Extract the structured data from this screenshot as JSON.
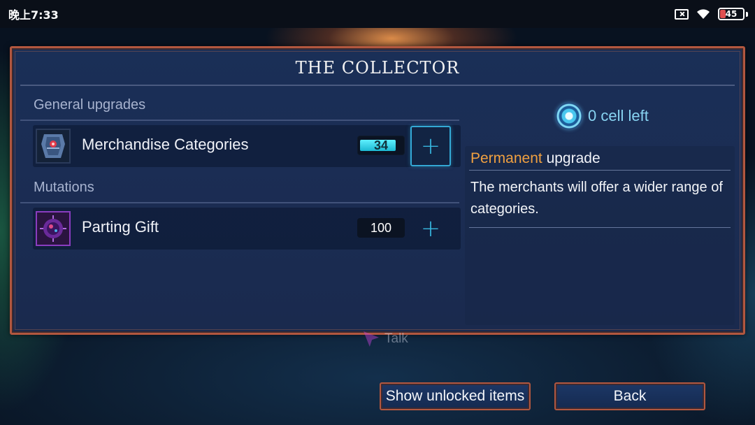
{
  "status_bar": {
    "time": "晚上7:33",
    "battery_level": "45"
  },
  "panel": {
    "title": "THE COLLECTOR"
  },
  "sections": {
    "general": "General upgrades",
    "mutations": "Mutations"
  },
  "upgrades": [
    {
      "label": "Merchandise Categories",
      "cost": "34",
      "cost_progress": 0.85
    },
    {
      "label": "Parting Gift",
      "cost": "100"
    }
  ],
  "cells": {
    "text": "0 cell left"
  },
  "info": {
    "accent": "Permanent",
    "heading_rest": " upgrade",
    "description": "The merchants will offer a wider range of categories."
  },
  "talk_hint": "Talk",
  "buttons": {
    "show_unlocked": "Show unlocked items",
    "back": "Back"
  },
  "colors": {
    "frame": "#b2573f",
    "panel_bg": "#1a2f57",
    "accent_orange": "#f0a040",
    "cell_cyan": "#88d4f2",
    "plus_cyan": "#37b7e0"
  }
}
